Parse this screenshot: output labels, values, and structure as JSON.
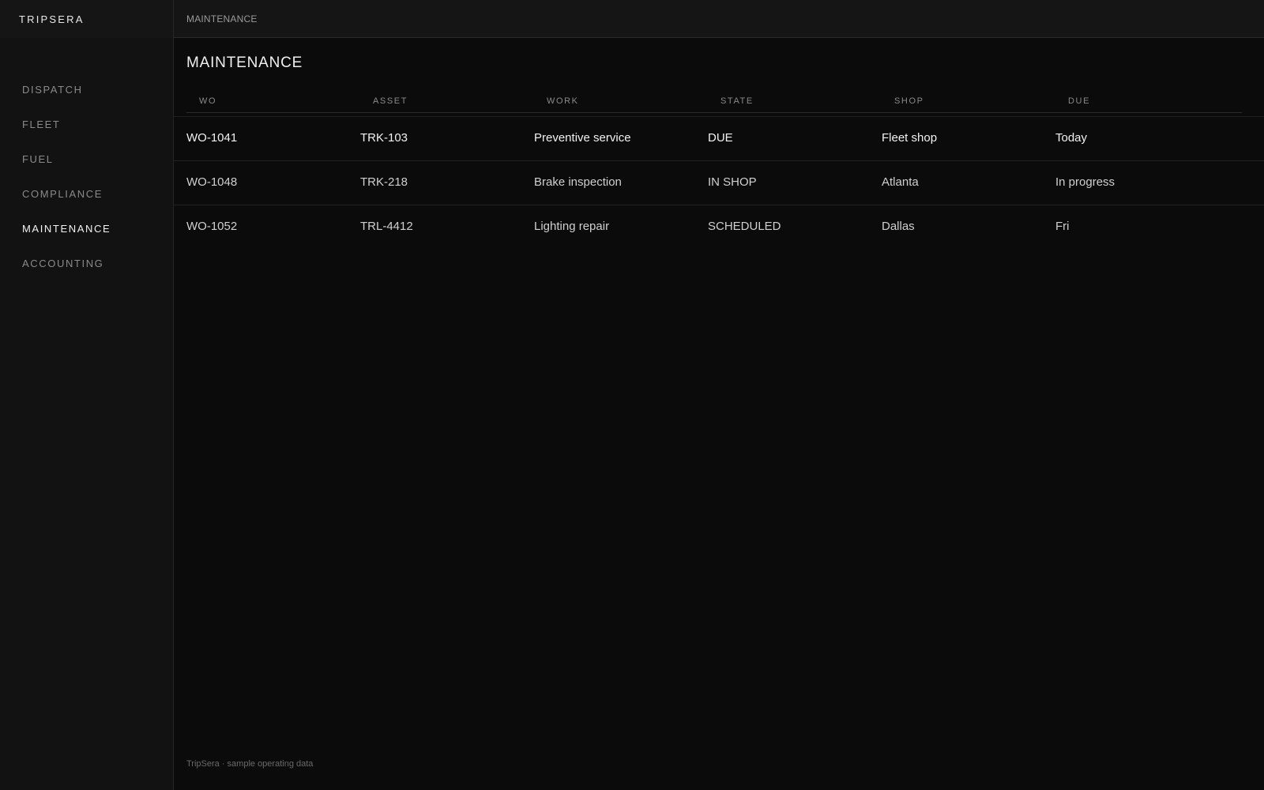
{
  "brand": "TRIPSERA",
  "breadcrumb": "MAINTENANCE",
  "sidebar": {
    "items": [
      {
        "label": "DISPATCH"
      },
      {
        "label": "FLEET"
      },
      {
        "label": "FUEL"
      },
      {
        "label": "COMPLIANCE"
      },
      {
        "label": "MAINTENANCE",
        "active": true
      },
      {
        "label": "ACCOUNTING"
      }
    ]
  },
  "main": {
    "title": "MAINTENANCE",
    "table": {
      "columns": [
        "WO",
        "ASSET",
        "WORK",
        "STATE",
        "SHOP",
        "DUE"
      ],
      "rows": [
        [
          "WO-1041",
          "TRK-103",
          "Preventive service",
          "DUE",
          "Fleet shop",
          "Today"
        ],
        [
          "WO-1048",
          "TRK-218",
          "Brake inspection",
          "IN SHOP",
          "Atlanta",
          "In progress"
        ],
        [
          "WO-1052",
          "TRL-4412",
          "Lighting repair",
          "SCHEDULED",
          "Dallas",
          "Fri"
        ]
      ]
    }
  },
  "footer": "TripSera · sample operating data",
  "colors": {
    "background": "#0b0b0b",
    "sidebar": "#121212",
    "text_primary": "#f2f2f2",
    "text_muted": "#8a8a8a"
  }
}
